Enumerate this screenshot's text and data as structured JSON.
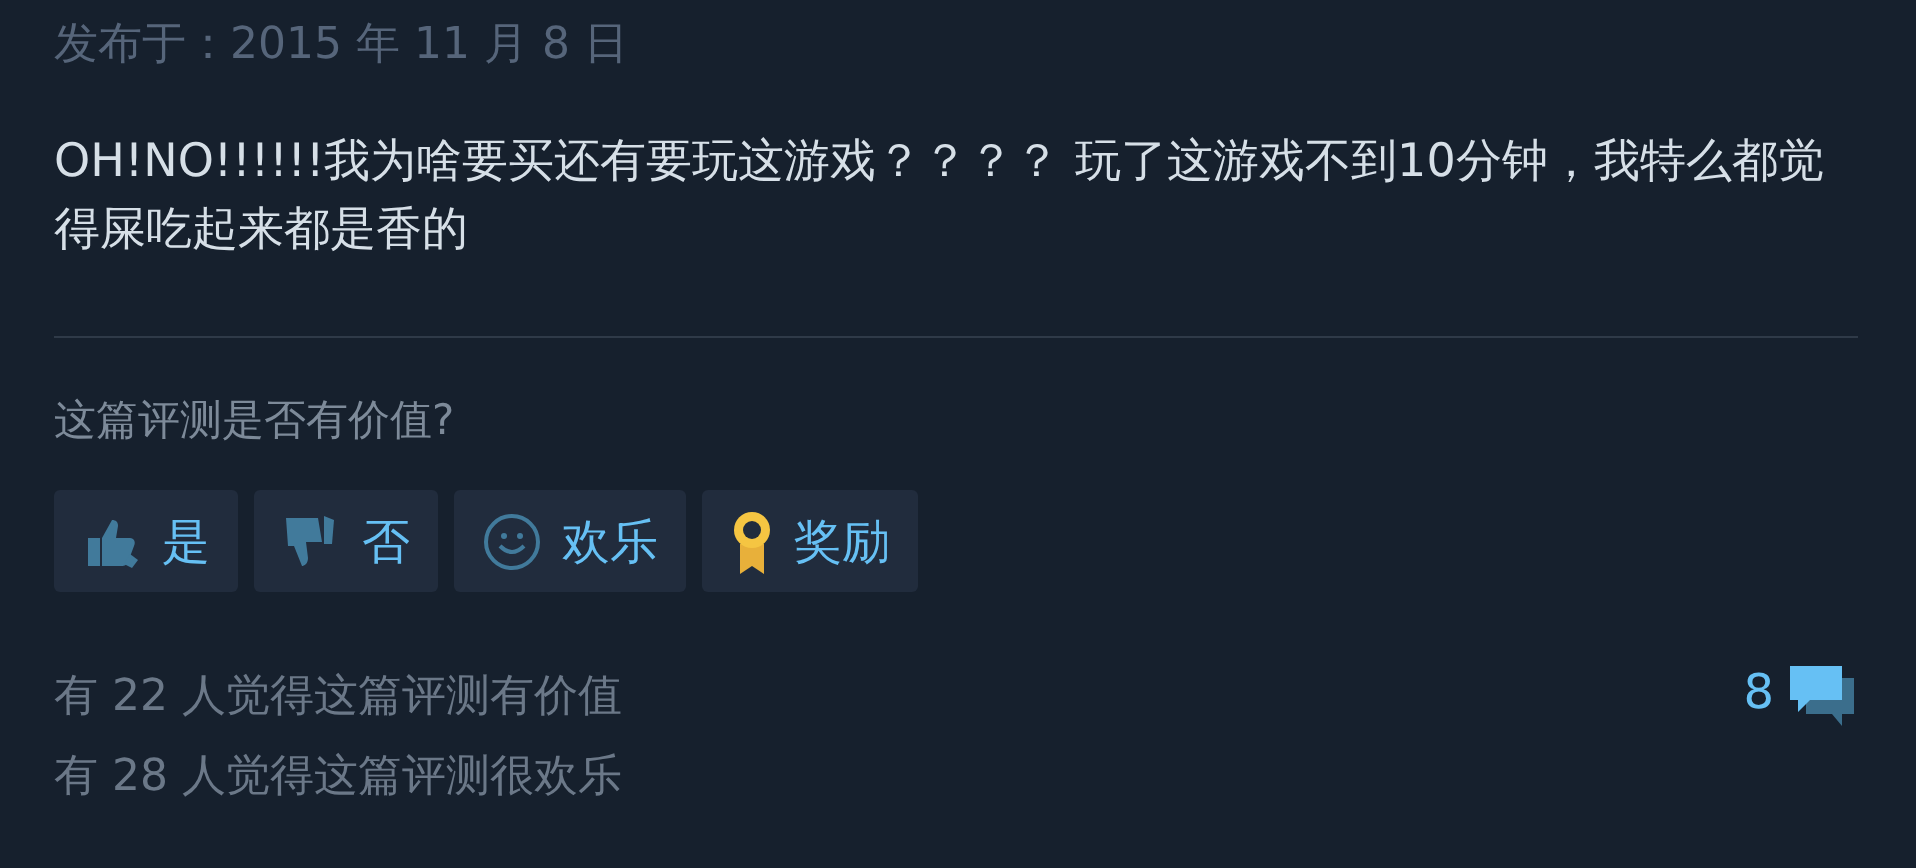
{
  "posted_date": "发布于：2015 年 11 月 8 日",
  "review_text": "OH!NO!!!!!!我为啥要买还有要玩这游戏？？？？ 玩了这游戏不到10分钟，我特么都觉得屎吃起来都是香的",
  "helpful_prompt": "这篇评测是否有价值?",
  "buttons": [
    {
      "kind": "thumbs_up",
      "label": "是"
    },
    {
      "kind": "thumbs_down",
      "label": "否"
    },
    {
      "kind": "funny",
      "label": "欢乐"
    },
    {
      "kind": "award",
      "label": "奖励"
    }
  ],
  "stats": [
    "有 22 人觉得这篇评测有价值",
    "有 28 人觉得这篇评测很欢乐"
  ],
  "comment_count": "8"
}
